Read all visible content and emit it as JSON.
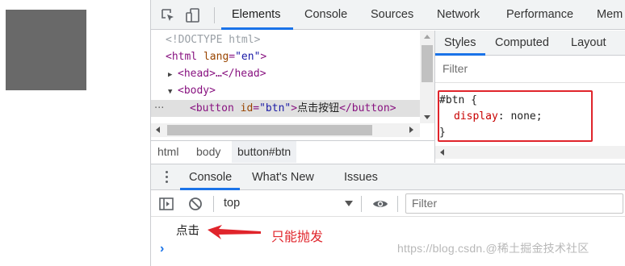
{
  "devtools": {
    "tabs": [
      "Elements",
      "Console",
      "Sources",
      "Network",
      "Performance",
      "Mem"
    ],
    "dom": {
      "doctype": "<!DOCTYPE html>",
      "html_open_tag": "<html",
      "html_attr": "lang",
      "html_attr_value": "\"en\"",
      "html_close_bracket": ">",
      "head_line": "<head>…</head>",
      "body_line": "<body>",
      "button_tag_open": "<button",
      "button_attr": "id",
      "button_attr_value": "\"btn\"",
      "button_text": "点击按钮",
      "button_close": "</button>",
      "ellipsis": "···",
      "eq": "=",
      "gt": ">"
    },
    "breadcrumbs": [
      "html",
      "body",
      "button#btn"
    ],
    "styles": {
      "subtabs": [
        "Styles",
        "Computed",
        "Layout"
      ],
      "filter_placeholder": "Filter",
      "selector": "#btn {",
      "property": "display",
      "value": "none;",
      "close_brace": "}",
      "colon": ": "
    },
    "drawer": {
      "tabs": [
        "Console",
        "What's New",
        "Issues"
      ],
      "context": "top",
      "filter_placeholder": "Filter",
      "log": "点击",
      "prompt": "›"
    }
  },
  "annotation": {
    "text": "只能抛发",
    "color": "#e0242b"
  },
  "watermark": "https://blog.csdn.@稀土掘金技术社区",
  "colors": {
    "accent": "#1a73e8",
    "gray_box": "#696969"
  }
}
